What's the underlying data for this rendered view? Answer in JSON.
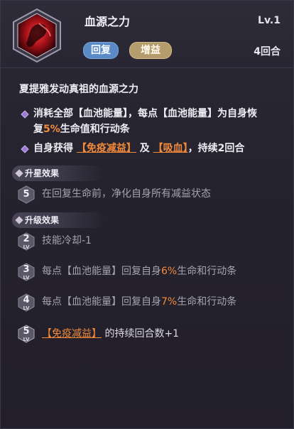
{
  "header": {
    "title": "血源之力",
    "level": "Lv.1",
    "tags": [
      "回复",
      "增益"
    ],
    "duration": "4回合"
  },
  "description": {
    "title": "夏提雅发动真祖的血源之力",
    "lines": [
      {
        "part1": "消耗全部【血池能量】，每点【血池能量】为自身恢",
        "part2a": "复",
        "pct": "5%",
        "part2b": "生命值和行动条"
      },
      {
        "part1": "自身获得",
        "link1": "【免疫减益】",
        "mid": "及",
        "link2": "【吸血】",
        "end": "，持续2回合"
      }
    ]
  },
  "sections": {
    "star": "升星效果",
    "upgrade": "升级效果"
  },
  "star_rows": [
    {
      "num": "5",
      "text": "在回复生命前，净化自身所有减益状态"
    }
  ],
  "upgrade_rows": [
    {
      "num": "2",
      "lv": "LV",
      "text": "技能冷却-1"
    },
    {
      "num": "3",
      "lv": "LV",
      "text_a": "每点【血池能量】回复自身",
      "pct": "6%",
      "text_b": "生命和行动条"
    },
    {
      "num": "4",
      "lv": "LV",
      "text_a": "每点【血池能量】回复自身",
      "pct": "7%",
      "text_b": "生命和行动条"
    },
    {
      "num": "5",
      "lv": "LV",
      "link": "【免疫减益】",
      "text_b": "的持续回合数+1"
    }
  ],
  "colors": {
    "accent_orange": "#f28a3a",
    "heal_tag": "#5b8ac7",
    "buff_tag": "#b49c6c",
    "bullet": "#9a7bd0"
  },
  "icons": {
    "skill": "blood-skill-icon",
    "bullet": "diamond-bullet-icon"
  }
}
